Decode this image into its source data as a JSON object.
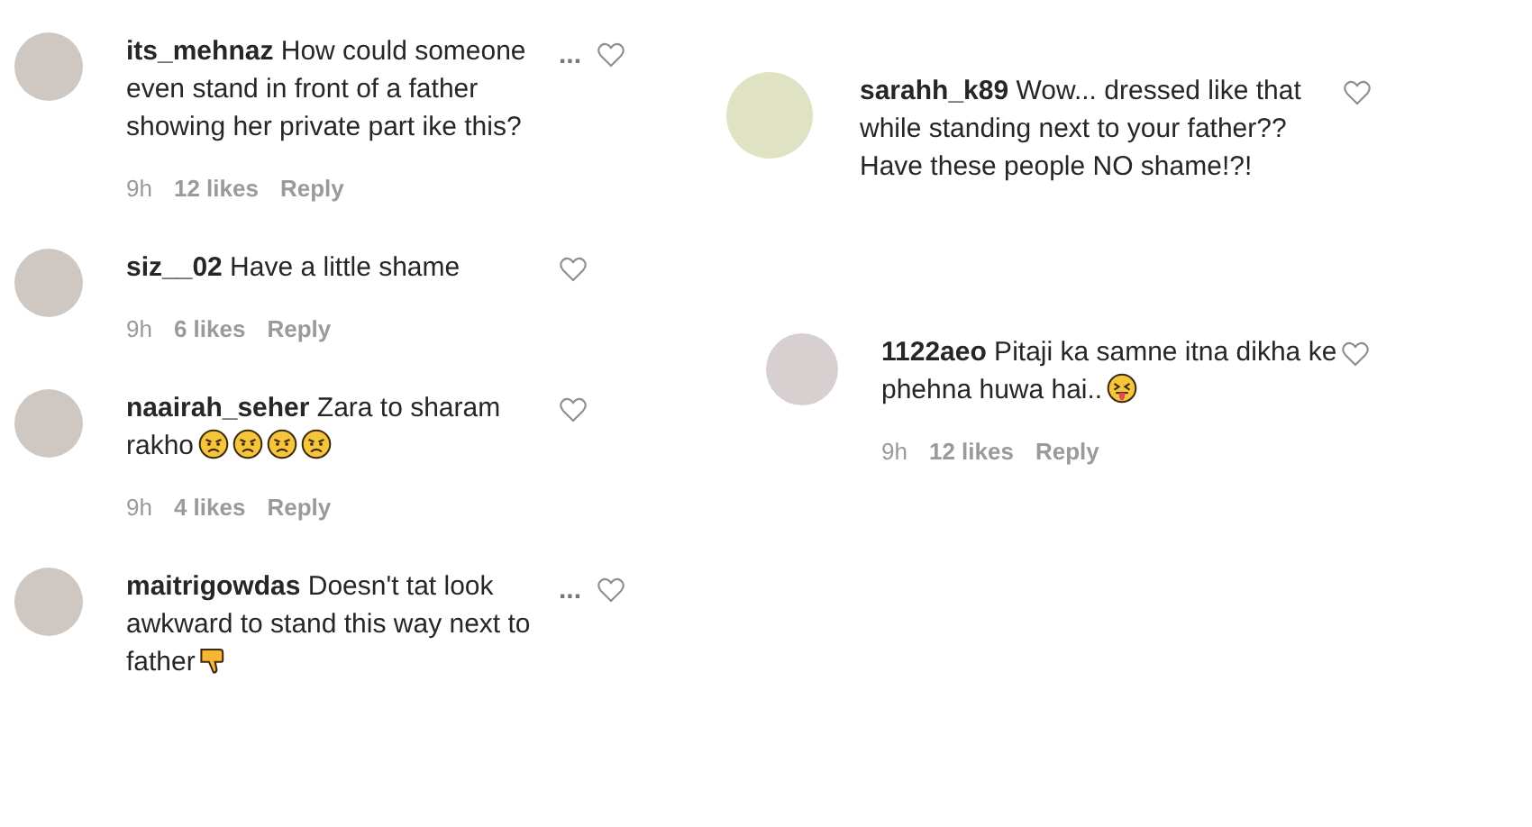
{
  "columns": [
    {
      "comments": [
        {
          "username": "its_mehnaz",
          "text": "How could someone even stand in front of a father showing her private part ike this?",
          "more": "...",
          "meta": {
            "time": "9h",
            "likes": "12 likes",
            "reply": "Reply"
          }
        },
        {
          "username": "siz__02",
          "text": "Have a little shame",
          "meta": {
            "time": "9h",
            "likes": "6 likes",
            "reply": "Reply"
          }
        },
        {
          "username": "naairah_seher",
          "text": "Zara to sharam rakho",
          "icons": [
            {
              "kind": "angry-face"
            },
            {
              "kind": "angry-face"
            },
            {
              "kind": "angry-face"
            },
            {
              "kind": "angry-face"
            }
          ],
          "meta": {
            "time": "9h",
            "likes": "4 likes",
            "reply": "Reply"
          }
        },
        {
          "username": "maitrigowdas",
          "text": "Doesn't tat look awkward to stand this way next to father",
          "more": "...",
          "icons": [
            {
              "kind": "thumbs-down"
            }
          ]
        }
      ]
    },
    {
      "comments": [
        {
          "username": "sarahh_k89",
          "text": "Wow... dressed like that while standing next to your father?? Have these people NO shame!?!",
          "replies": [
            {
              "username": "1122aeo",
              "text": "Pitaji ka samne itna dikha ke phehna huwa hai..",
              "icons": [
                {
                  "kind": "tongue-face"
                }
              ],
              "meta": {
                "time": "9h",
                "likes": "12 likes",
                "reply": "Reply"
              }
            }
          ]
        }
      ]
    }
  ]
}
